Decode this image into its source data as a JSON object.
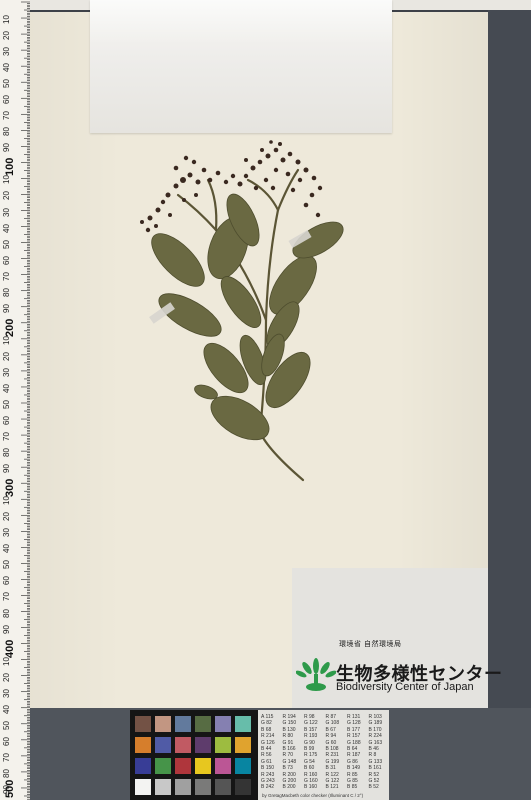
{
  "ruler": {
    "major_labels": [
      "100",
      "200",
      "300",
      "400",
      "500"
    ],
    "minor_labels": [
      "10",
      "20",
      "30",
      "40",
      "50",
      "60",
      "70",
      "80",
      "90",
      "10",
      "20",
      "30",
      "40",
      "50",
      "60",
      "70",
      "80",
      "90",
      "10",
      "20",
      "30",
      "40",
      "50",
      "60",
      "70",
      "80",
      "90",
      "10",
      "20",
      "30",
      "40",
      "50",
      "60",
      "70",
      "80",
      "90",
      "10",
      "20",
      "30",
      "40",
      "50",
      "60",
      "70",
      "80",
      "90"
    ]
  },
  "logo": {
    "org": "環境省 自然環境局",
    "title_jp": "生物多様性センター",
    "title_en": "Biodiversity Center of Japan"
  },
  "grey_card": {
    "rows": [
      [
        "A 115",
        "R 194",
        "R 98",
        "R 87",
        "R 131",
        "R 103"
      ],
      [
        "G 82",
        "G 150",
        "G 122",
        "G 108",
        "G 128",
        "G 189"
      ],
      [
        "B 68",
        "B 130",
        "B 157",
        "B 67",
        "B 177",
        "B 170"
      ],
      [
        "R 214",
        "R 80",
        "R 193",
        "R 94",
        "R 157",
        "R 224"
      ],
      [
        "G 126",
        "G 91",
        "G 90",
        "G 60",
        "G 188",
        "G 163"
      ],
      [
        "B 44",
        "B 166",
        "B 99",
        "B 108",
        "B 64",
        "B 46"
      ],
      [
        "R 56",
        "R 70",
        "R 175",
        "R 231",
        "R 187",
        "R 8"
      ],
      [
        "G 61",
        "G 148",
        "G 54",
        "G 199",
        "G 86",
        "G 133"
      ],
      [
        "B 150",
        "B 73",
        "B 60",
        "B 31",
        "B 149",
        "B 161"
      ],
      [
        "R 243",
        "R 200",
        "R 160",
        "R 122",
        "R 85",
        "R 52"
      ],
      [
        "G 243",
        "G 200",
        "G 160",
        "G 122",
        "G 85",
        "G 52"
      ],
      [
        "B 242",
        "B 200",
        "B 160",
        "B 121",
        "B 85",
        "B 52"
      ]
    ],
    "caption": "by GretagMacbeth color checker (Illuminant C / 2°)"
  },
  "colors": {
    "sheet": "#eee9da",
    "leaf": "#6b6a42",
    "flower": "#3b2a22"
  }
}
